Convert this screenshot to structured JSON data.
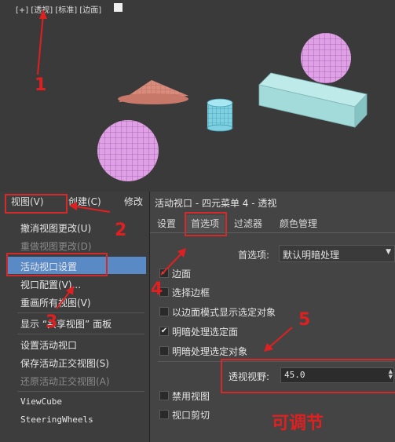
{
  "viewport": {
    "label": "[+] [透视] [标准] [边面]",
    "objects": [
      "cone",
      "cylinder",
      "sphere",
      "sphere",
      "box"
    ]
  },
  "menubar": {
    "view": "视图(V)",
    "create": "创建(C)",
    "modify": "修改"
  },
  "menu": {
    "items": [
      {
        "label": "撤消视图更改(U)",
        "disabled": false
      },
      {
        "label": "重做视图更改(D)",
        "disabled": true
      },
      {
        "label": "活动视口设置",
        "disabled": false
      },
      {
        "label": "视口配置(V)...",
        "disabled": false
      },
      {
        "label": "重画所有视图(V)",
        "disabled": false
      },
      {
        "label": "显示 “共享视图” 面板",
        "disabled": false
      },
      {
        "label": "设置活动视口",
        "disabled": false
      },
      {
        "label": "保存活动正交视图(S)",
        "disabled": false
      },
      {
        "label": "还原活动正交视图(A)",
        "disabled": true
      },
      {
        "label": "ViewCube",
        "disabled": false
      },
      {
        "label": "SteeringWheels",
        "disabled": false
      }
    ]
  },
  "dialog": {
    "title": "活动视口 - 四元菜单 4 - 透视",
    "tabs": [
      "设置",
      "首选项",
      "过滤器",
      "颜色管理"
    ],
    "active_tab": "首选项",
    "preset_label": "首选项:",
    "preset_value": "默认明暗处理",
    "checkboxes": [
      {
        "label": "边面",
        "checked": true
      },
      {
        "label": "选择边框",
        "checked": false
      },
      {
        "label": "以边面模式显示选定对象",
        "checked": false
      },
      {
        "label": "明暗处理选定面",
        "checked": true
      },
      {
        "label": "明暗处理选定对象",
        "checked": false
      },
      {
        "label": "禁用视图",
        "checked": false
      },
      {
        "label": "视口剪切",
        "checked": false
      }
    ],
    "fov_label": "透视视野:",
    "fov_value": "45.0"
  },
  "annotations": {
    "steps": [
      "1",
      "2",
      "3",
      "4",
      "5"
    ],
    "note": "可调节",
    "color": "#e02020"
  }
}
